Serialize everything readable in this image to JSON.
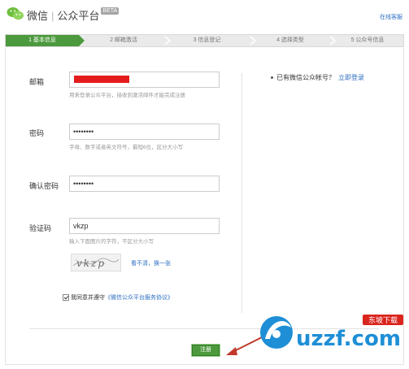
{
  "header": {
    "brand_name": "微信",
    "separator": "|",
    "product_name": "公众平台",
    "beta_badge": "BETA",
    "service_link": "在线客服"
  },
  "steps": [
    {
      "label": "1 基本信息",
      "active": true
    },
    {
      "label": "2 邮箱激活",
      "active": false
    },
    {
      "label": "3 信息登记",
      "active": false
    },
    {
      "label": "4 选择类型",
      "active": false
    },
    {
      "label": "5 公众号信息",
      "active": false
    }
  ],
  "form": {
    "email": {
      "label": "邮箱",
      "value": "",
      "hint": "用来登录公众平台，接收到激活邮件才能完成注册"
    },
    "password": {
      "label": "密码",
      "value": "••••••••",
      "hint": "字母、数字或者英文符号，最短6位，区分大小写"
    },
    "confirm_password": {
      "label": "确认密码",
      "value": "••••••••"
    },
    "captcha": {
      "label": "验证码",
      "value": "vkzp",
      "hint": "输入下面图片的字符，不区分大小写",
      "image_text": "vkzp",
      "refresh_link": "看不清，换一张"
    },
    "agree": {
      "checked": true,
      "text": "我同意并遵守",
      "link": "《微信公众平台服务协议》"
    },
    "submit_label": "注册"
  },
  "sidebar": {
    "question": "已有微信公众帐号？",
    "login_link": "立即登录"
  },
  "watermark": {
    "logo_text": "uzzf.com",
    "tagline": "东坡下载"
  },
  "colors": {
    "accent_green": "#4c9a3d",
    "link_blue": "#2b6ec2",
    "redaction_red": "#e41c1c",
    "annotation_arrow": "#c0392b",
    "watermark_blue": "#1e8fd6"
  }
}
